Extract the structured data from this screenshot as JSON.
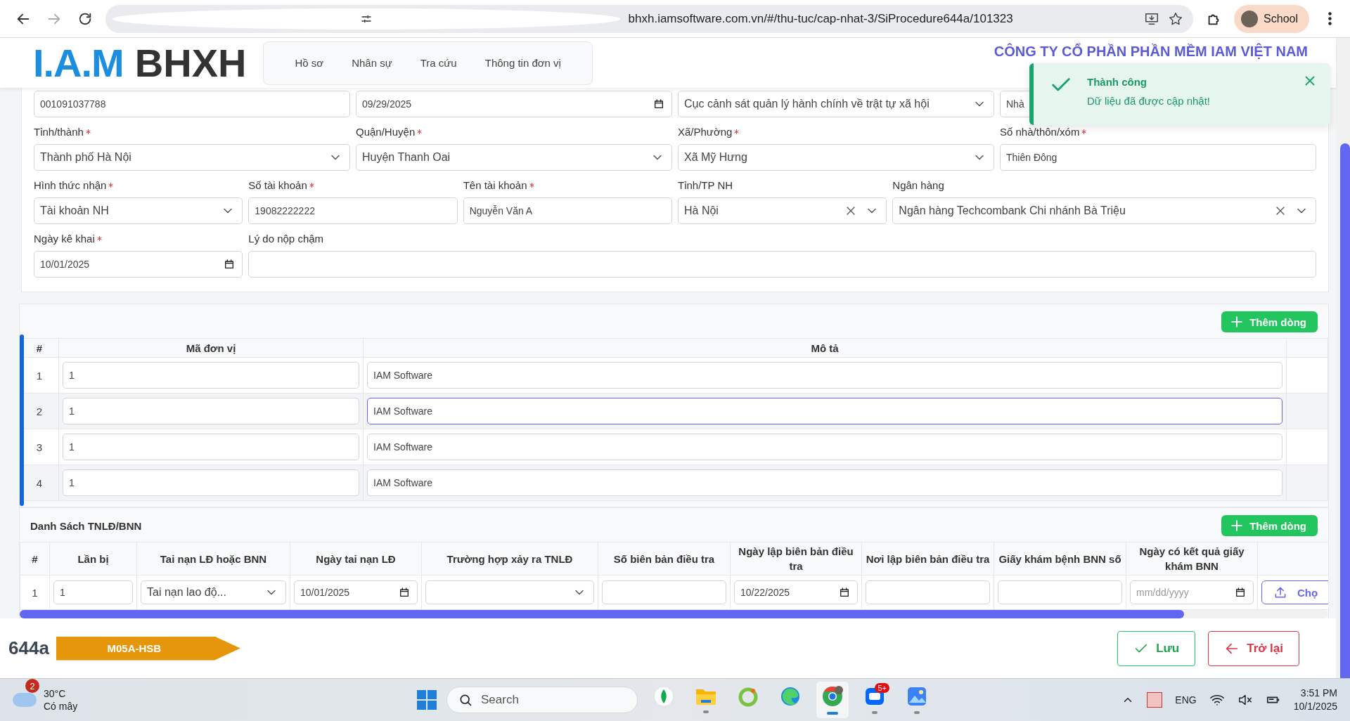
{
  "browser": {
    "url": "bhxh.iamsoftware.com.vn/#/thu-tuc/cap-nhat-3/SiProcedure644a/101323",
    "profile": "School",
    "can_go_forward": false
  },
  "header": {
    "logo": "I.A.M",
    "brand": "BHXH",
    "nav": [
      "Hồ sơ",
      "Nhân sự",
      "Tra cứu",
      "Thông tin đơn vị"
    ],
    "company": "CÔNG TY CỔ PHẦN PHẦN MỀM IAM VIỆT NAM"
  },
  "toast": {
    "title": "Thành công",
    "message": "Dữ liệu đã được cập nhật!"
  },
  "form": {
    "lines": [
      {
        "fields": [
          {
            "kind": "text",
            "value": "001091037788"
          },
          {
            "kind": "date",
            "value": "09/29/2025"
          },
          {
            "kind": "select",
            "value": "Cục cảnh sát quản lý hành chính về trật tự xã hội"
          },
          {
            "kind": "text",
            "value": "Nhà"
          }
        ]
      },
      {
        "fields": [
          {
            "label": "Tỉnh/thành",
            "required": true,
            "kind": "select",
            "value": "Thành phố Hà Nội"
          },
          {
            "label": "Quận/Huyện",
            "required": true,
            "kind": "select",
            "value": "Huyện Thanh Oai"
          },
          {
            "label": "Xã/Phường",
            "required": true,
            "kind": "select",
            "value": "Xã Mỹ Hưng"
          },
          {
            "label": "Số nhà/thôn/xóm",
            "required": true,
            "kind": "text",
            "value": "Thiên Đông"
          }
        ]
      },
      {
        "fields": [
          {
            "label": "Hình thức nhận",
            "required": true,
            "kind": "select",
            "value": "Tài khoản NH"
          },
          {
            "label": "Số tài khoản",
            "required": true,
            "kind": "text",
            "value": "19082222222"
          },
          {
            "label": "Tên tài khoản",
            "required": true,
            "kind": "text",
            "value": "Nguyễn Văn A"
          },
          {
            "label": "Tỉnh/TP NH",
            "required": false,
            "kind": "select",
            "value": "Hà Nội",
            "clearable": true
          },
          {
            "label": "Ngân hàng",
            "required": false,
            "kind": "select",
            "value": "Ngân hàng Techcombank Chi nhánh Bà Triệu",
            "clearable": true
          }
        ]
      },
      {
        "fields": [
          {
            "label": "Ngày kê khai",
            "required": true,
            "kind": "date",
            "value": "10/01/2025"
          },
          {
            "label": "Lý do nộp chậm",
            "required": false,
            "kind": "text"
          }
        ]
      }
    ]
  },
  "units": {
    "add_button": "Thêm dòng",
    "columns": [
      "#",
      "Mã đơn vị",
      "Mô tả"
    ],
    "rows": [
      {
        "number": "1",
        "code": "1",
        "description": "IAM Software",
        "focused": false
      },
      {
        "number": "2",
        "code": "1",
        "description": "IAM Software",
        "focused": true
      },
      {
        "number": "3",
        "code": "1",
        "description": "IAM Software",
        "focused": false
      },
      {
        "number": "4",
        "code": "1",
        "description": "IAM Software",
        "focused": false
      }
    ]
  },
  "accidents": {
    "title": "Danh Sách TNLĐ/BNN",
    "add_button": "Thêm dòng",
    "columns": [
      "#",
      "Lần bị",
      "Tai nạn LĐ hoặc BNN",
      "Ngày tai nạn LĐ",
      "Trường hợp xảy ra TNLĐ",
      "Số biên bản điều tra",
      "Ngày lập biên bản điều tra",
      "Nơi lập biên bản điều tra",
      "Giấy khám bệnh BNN số",
      "Ngày có kết quả giấy khám BNN"
    ],
    "rows": [
      {
        "cells": [
          {
            "kind": "number",
            "value": "1"
          },
          {
            "kind": "text",
            "value": "1"
          },
          {
            "kind": "select",
            "value": "Tai nạn lao độ..."
          },
          {
            "kind": "date",
            "value": "10/01/2025"
          },
          {
            "kind": "select"
          },
          {
            "kind": "text"
          },
          {
            "kind": "date",
            "value": "10/22/2025"
          },
          {
            "kind": "text"
          },
          {
            "kind": "text"
          },
          {
            "kind": "date",
            "placeholder": "mm/dd/yyyy"
          },
          {
            "kind": "upload",
            "value": "Chọ"
          }
        ]
      }
    ]
  },
  "footer": {
    "procedure": "644a",
    "form_code": "M05A-HSB",
    "buttons": [
      {
        "kind": "save",
        "label": "Lưu"
      },
      {
        "kind": "back",
        "label": "Trở lại"
      }
    ]
  },
  "taskbar": {
    "weather": {
      "badge": "2",
      "temperature": "30°C",
      "condition": "Có mây"
    },
    "search": {
      "placeholder": "Search"
    },
    "apps": [
      {
        "kind": "leaf",
        "selected": false,
        "running": false
      },
      {
        "kind": "folder",
        "selected": false,
        "running": true
      },
      {
        "kind": "ring",
        "selected": false,
        "running": false
      },
      {
        "kind": "edge",
        "selected": false,
        "running": false
      },
      {
        "kind": "chrome",
        "selected": true,
        "running": true
      },
      {
        "kind": "chat",
        "selected": false,
        "running": true,
        "badge": "5+"
      },
      {
        "kind": "photos",
        "selected": false,
        "running": true
      }
    ],
    "tray": {
      "language": "ENG",
      "time": "3:51 PM",
      "date": "10/1/2025"
    }
  }
}
